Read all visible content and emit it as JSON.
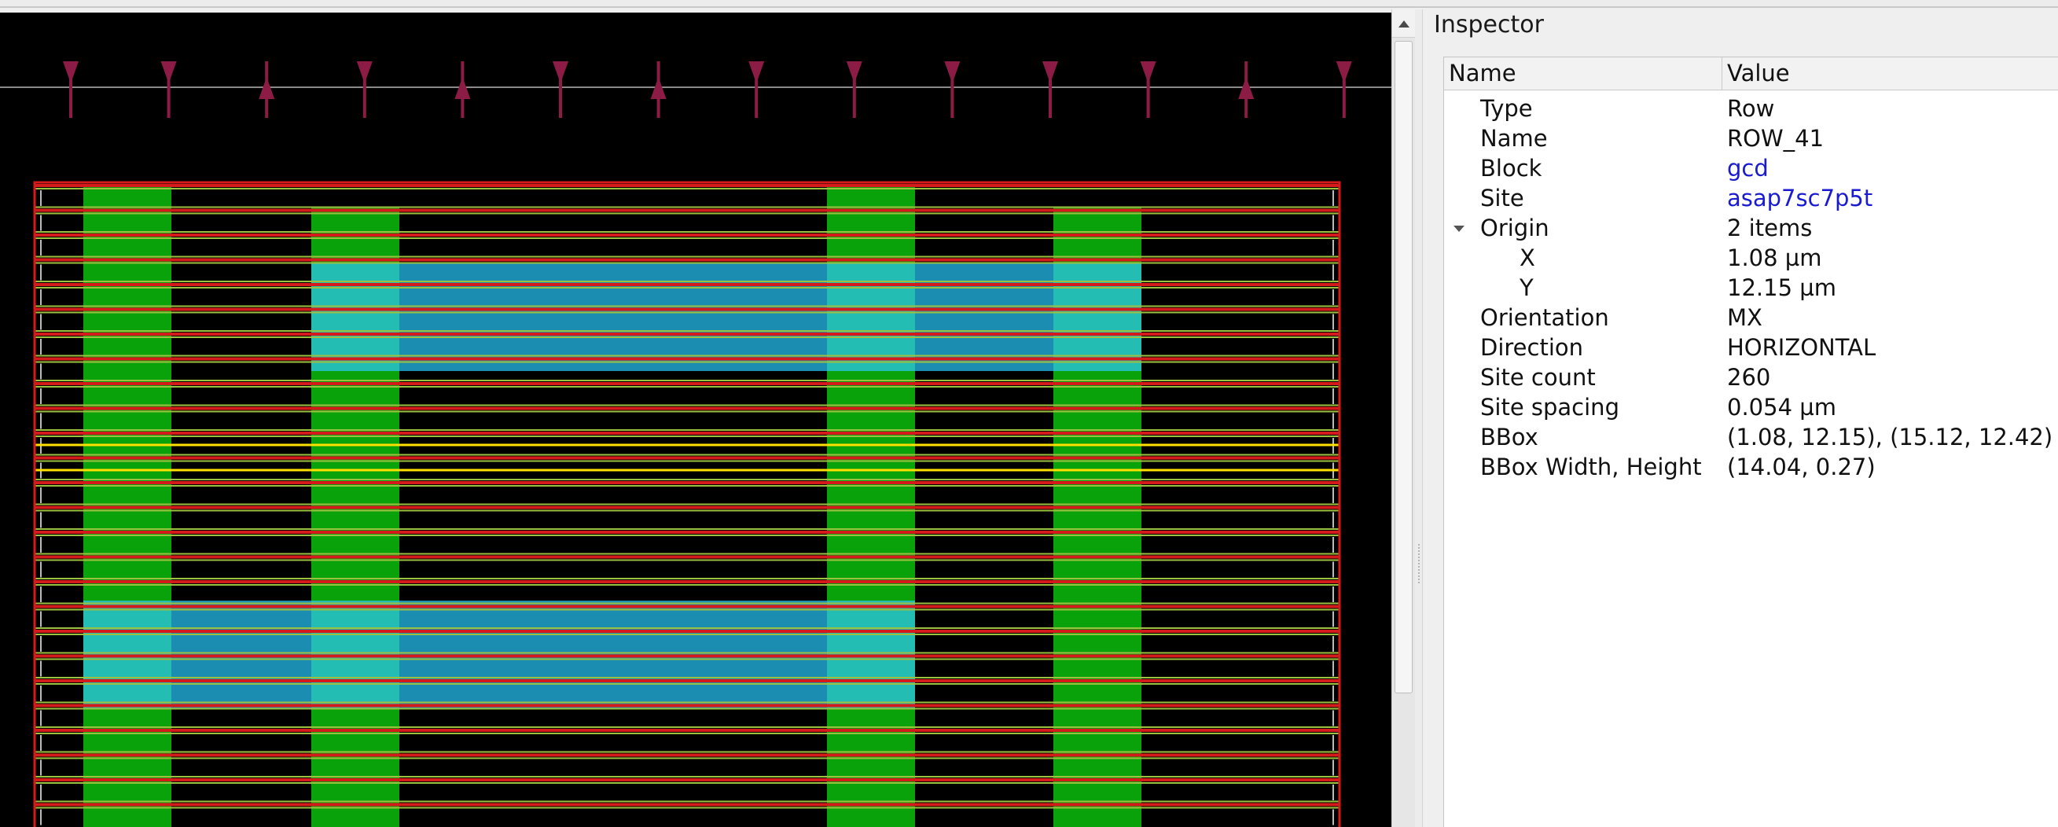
{
  "inspector": {
    "title": "Inspector",
    "columns": {
      "name": "Name",
      "value": "Value"
    },
    "rows": [
      {
        "key": "Type",
        "value": "Row",
        "indent": 1,
        "link": false
      },
      {
        "key": "Name",
        "value": "ROW_41",
        "indent": 1,
        "link": false
      },
      {
        "key": "Block",
        "value": "gcd",
        "indent": 1,
        "link": true
      },
      {
        "key": "Site",
        "value": "asap7sc7p5t",
        "indent": 1,
        "link": true
      },
      {
        "key": "Origin",
        "value": "2 items",
        "indent": 1,
        "link": false,
        "expanded": true
      },
      {
        "key": "X",
        "value": "1.08 µm",
        "indent": 2,
        "link": false
      },
      {
        "key": "Y",
        "value": "12.15 µm",
        "indent": 2,
        "link": false
      },
      {
        "key": "Orientation",
        "value": "MX",
        "indent": 1,
        "link": false
      },
      {
        "key": "Direction",
        "value": "HORIZONTAL",
        "indent": 1,
        "link": false
      },
      {
        "key": "Site count",
        "value": "260",
        "indent": 1,
        "link": false
      },
      {
        "key": "Site spacing",
        "value": "0.054 µm",
        "indent": 1,
        "link": false
      },
      {
        "key": "BBox",
        "value": "(1.08, 12.15), (15.12, 12.42)",
        "indent": 1,
        "link": false
      },
      {
        "key": "BBox Width, Height",
        "value": "(14.04, 0.27)",
        "indent": 1,
        "link": false
      }
    ]
  },
  "layout_view": {
    "colors": {
      "background": "#000000",
      "pin_marker": "#8c1c45",
      "row_line": "#d41a1a",
      "row_outline": "#9cc040",
      "stripe": "#0aa20a",
      "block": "#1fa0c8",
      "highlight": "#ffe000"
    },
    "pin_directions": [
      "down",
      "down",
      "up",
      "down",
      "up",
      "down",
      "up",
      "down",
      "down",
      "down",
      "down",
      "down",
      "up",
      "down"
    ],
    "icons": {
      "scroll_up": "chevron-up-icon",
      "tree_expand": "chevron-down-icon"
    }
  }
}
